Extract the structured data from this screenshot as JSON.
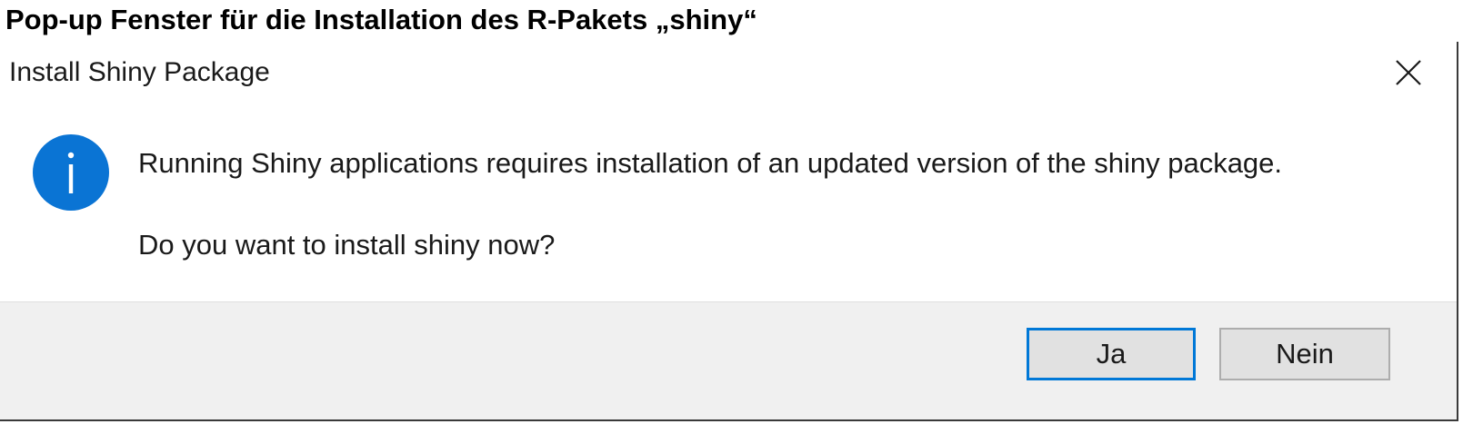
{
  "caption": "Pop-up Fenster für die Installation des R-Pakets „shiny“",
  "dialog": {
    "title": "Install Shiny Package",
    "close_icon": "close-icon",
    "icon": "info-icon",
    "accent_color": "#0078d7",
    "message_line1": "Running Shiny applications requires installation of an updated version of the shiny package.",
    "message_line2": "Do you want to install shiny now?",
    "buttons": {
      "yes_label": "Ja",
      "no_label": "Nein"
    }
  }
}
